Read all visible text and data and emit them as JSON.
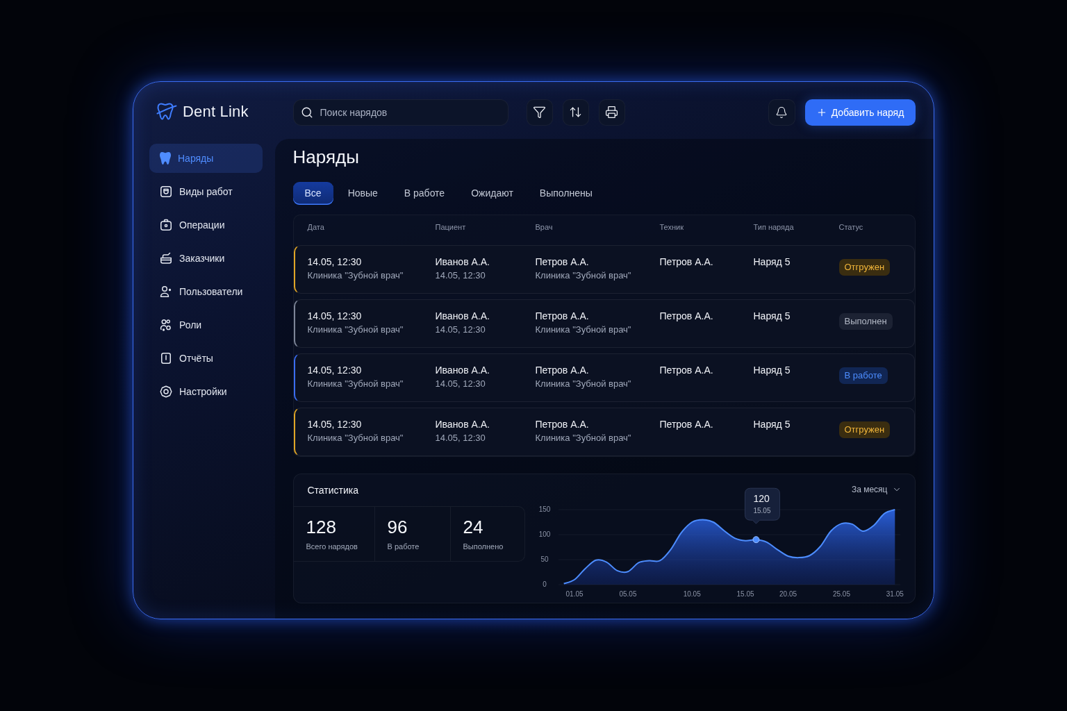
{
  "sidebar": {
    "logo": {
      "text": "Dent Link"
    },
    "items": [
      {
        "label": "Наряды",
        "selected": true
      },
      {
        "label": "Виды работ",
        "selected": false
      },
      {
        "label": "Операции",
        "selected": false
      },
      {
        "label": "Заказчики",
        "selected": false
      },
      {
        "label": "Пользователи",
        "selected": false
      },
      {
        "label": "Роли",
        "selected": false
      },
      {
        "label": "Отчёты",
        "selected": false
      },
      {
        "label": "Настройки",
        "selected": false
      }
    ]
  },
  "toolbar": {
    "search": {
      "placeholder": "Поиск нарядов"
    },
    "add_button": {
      "label": "Добавить наряд"
    }
  },
  "page_title": "Наряды",
  "tabs": [
    {
      "label": "Все",
      "selected": true
    },
    {
      "label": "Новые",
      "selected": false
    },
    {
      "label": "В работе",
      "selected": false
    },
    {
      "label": "Ожидают",
      "selected": false
    },
    {
      "label": "Выполнены",
      "selected": false
    }
  ],
  "table": {
    "columns": [
      "Дата",
      "Пациент",
      "Врач",
      "Техник",
      "Тип наряда",
      "Статус"
    ],
    "rows": [
      {
        "date": "14.05, 12:30",
        "clinic": "Клиника \"Зубной врач\"",
        "patient": "Иванов А.А.",
        "patient_date": "14.05, 12:30",
        "doctor": "Петров А.А.",
        "doctor_clinic": "Клиника \"Зубной врач\"",
        "technician": "Петров А.А.",
        "order_type": "Наряд 5",
        "status": {
          "label": "Отгружен",
          "kind": "shipped"
        }
      },
      {
        "date": "14.05, 12:30",
        "clinic": "Клиника \"Зубной врач\"",
        "patient": "Иванов А.А.",
        "patient_date": "14.05, 12:30",
        "doctor": "Петров А.А.",
        "doctor_clinic": "Клиника \"Зубной врач\"",
        "technician": "Петров А.А.",
        "order_type": "Наряд 5",
        "status": {
          "label": "Выполнен",
          "kind": "done"
        }
      },
      {
        "date": "14.05, 12:30",
        "clinic": "Клиника \"Зубной врач\"",
        "patient": "Иванов А.А.",
        "patient_date": "14.05, 12:30",
        "doctor": "Петров А.А.",
        "doctor_clinic": "Клиника \"Зубной врач\"",
        "technician": "Петров А.А.",
        "order_type": "Наряд 5",
        "status": {
          "label": "В работе",
          "kind": "in_progress"
        }
      },
      {
        "date": "14.05, 12:30",
        "clinic": "Клиника \"Зубной врач\"",
        "patient": "Иванов А.А.",
        "patient_date": "14.05, 12:30",
        "doctor": "Петров А.А.",
        "doctor_clinic": "Клиника \"Зубной врач\"",
        "technician": "Петров А.А.",
        "order_type": "Наряд 5",
        "status": {
          "label": "Отгружен",
          "kind": "shipped"
        }
      }
    ]
  },
  "statistics": {
    "title": "Статистика",
    "period": "За месяц",
    "stats": [
      {
        "value": "128",
        "label": "Всего нарядов"
      },
      {
        "value": "96",
        "label": "В работе"
      },
      {
        "value": "24",
        "label": "Выполнено"
      }
    ],
    "chart_data": {
      "type": "area",
      "categories": [
        null,
        "01.05",
        null,
        null,
        null,
        null,
        "05.05",
        null,
        null,
        null,
        null,
        null,
        "10.05",
        null,
        null,
        null,
        null,
        "15.05",
        null,
        null,
        null,
        "20.05",
        null,
        null,
        null,
        null,
        "25.05",
        null,
        null,
        null,
        null,
        "31.05"
      ],
      "values": [
        2,
        10,
        32,
        49,
        45,
        28,
        26,
        44,
        48,
        48,
        70,
        104,
        125,
        130,
        125,
        108,
        93,
        88,
        90,
        85,
        70,
        57,
        54,
        58,
        76,
        107,
        122,
        121,
        107,
        118,
        142,
        150
      ],
      "ylim": [
        0,
        150
      ],
      "yticks": [
        0,
        50,
        100,
        150
      ],
      "grid": true
    },
    "tooltip": {
      "value": "120",
      "date": "15.05"
    }
  }
}
